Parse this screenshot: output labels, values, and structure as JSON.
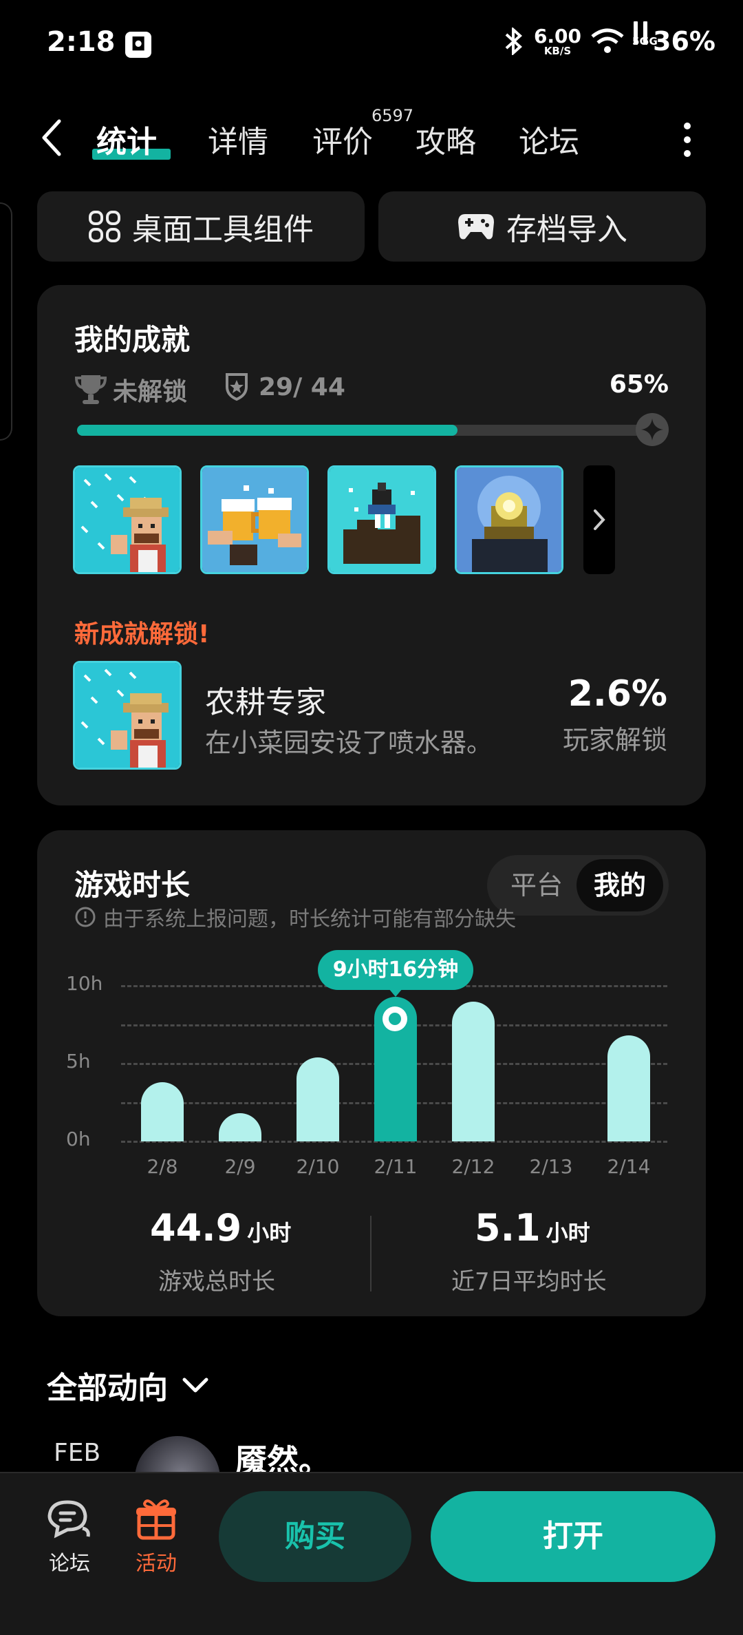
{
  "status": {
    "time": "2:18",
    "app_icon": "app-icon",
    "speed_value": "6.00",
    "speed_unit": "KB/S",
    "sig1": "5G",
    "sig2": "5G",
    "battery": "36%"
  },
  "nav": {
    "tabs": [
      "统计",
      "详情",
      "评价",
      "攻略",
      "论坛"
    ],
    "review_count": "6597"
  },
  "tools": {
    "widget_label": "桌面工具组件",
    "import_label": "存档导入"
  },
  "achievements": {
    "title": "我的成就",
    "locked_label": "未解锁",
    "count": "29/ 44",
    "percent": "65%",
    "progress": 0.65,
    "new_title": "新成就解锁!",
    "new_name": "农耕专家",
    "new_desc": "在小菜园安设了喷水器。",
    "new_pct": "2.6%",
    "new_pct_label": "玩家解锁"
  },
  "playtime": {
    "title": "游戏时长",
    "seg_platform": "平台",
    "seg_mine": "我的",
    "note": "由于系统上报问题，时长统计可能有部分缺失",
    "tooltip": "9小时16分钟",
    "total_value": "44.9",
    "total_unit": "小时",
    "total_label": "游戏总时长",
    "avg_value": "5.1",
    "avg_unit": "小时",
    "avg_label": "近7日平均时长"
  },
  "chart_data": {
    "type": "bar",
    "categories": [
      "2/8",
      "2/9",
      "2/10",
      "2/11",
      "2/12",
      "2/13",
      "2/14"
    ],
    "values": [
      3.8,
      1.8,
      5.4,
      9.3,
      9.0,
      0,
      6.8
    ],
    "yticks": [
      "10h",
      "5h",
      "0h"
    ],
    "ylim": [
      0,
      10
    ],
    "selected_index": 3,
    "colors": {
      "bar": "#b3f1ec",
      "selected": "#13b3a1"
    }
  },
  "activity": {
    "title": "全部动向",
    "month": "FEB",
    "user": "魇然。"
  },
  "bottom": {
    "forum_label": "论坛",
    "event_label": "活动",
    "buy_label": "购买",
    "open_label": "打开"
  },
  "colors": {
    "accent": "#13b3a1",
    "orange": "#ff6a3a"
  }
}
